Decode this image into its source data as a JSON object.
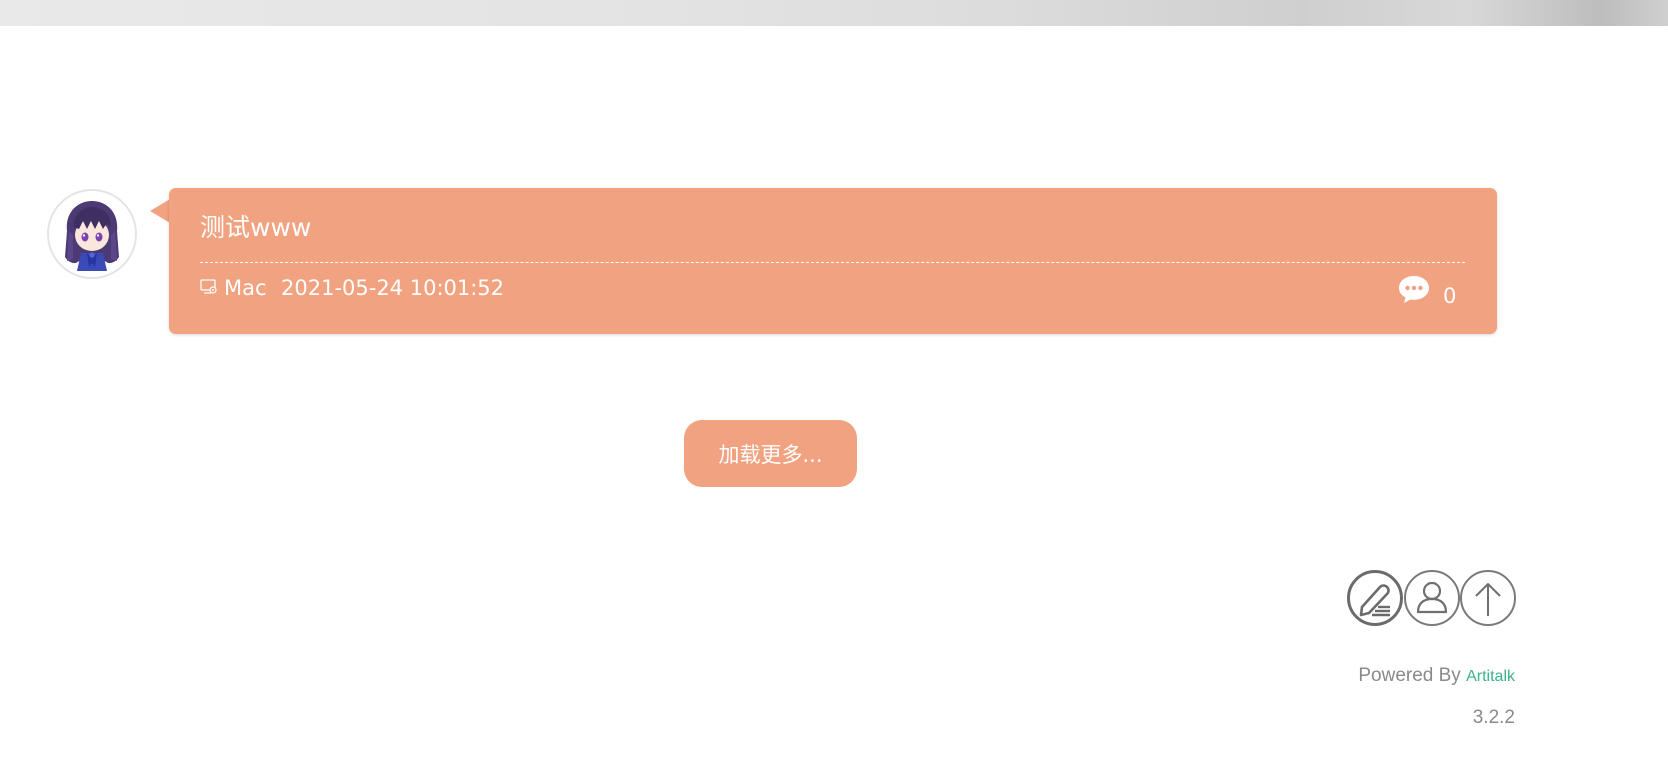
{
  "post": {
    "title": "测试www",
    "device": "Mac",
    "time": "2021-05-24 10:01:52",
    "comment_count": "0"
  },
  "load_more_label": "加载更多...",
  "footer": {
    "powered_by": "Powered By",
    "brand": "Artitalk",
    "version": "3.2.2"
  },
  "fabs": {
    "edit_icon": "edit-icon",
    "user_icon": "user-icon",
    "top_icon": "arrow-up-icon"
  },
  "colors": {
    "accent": "#f1a280",
    "brand_link": "#3cb38a",
    "muted_text": "#8a8a8a"
  }
}
